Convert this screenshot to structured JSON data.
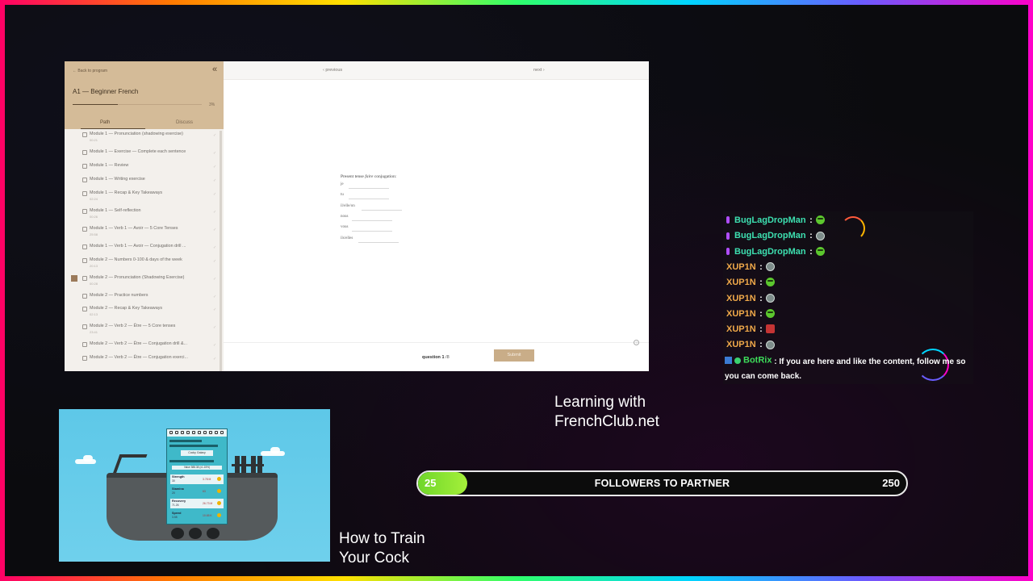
{
  "browser": {
    "sidebar": {
      "back_link": "← Back to program",
      "course_title": "A1 — Beginner French",
      "progress_pct": "3%",
      "progress_fraction": 0.35,
      "tabs": {
        "path": "Path",
        "discuss": "Discuss"
      },
      "lessons": [
        {
          "title": "Module 1 — Pronunciation (shadowing exercise)",
          "sub": "00:21"
        },
        {
          "title": "Module 1 — Exercise — Complete each sentence",
          "sub": ""
        },
        {
          "title": "Module 1 — Review",
          "sub": ""
        },
        {
          "title": "Module 1 — Writing exercise",
          "sub": ""
        },
        {
          "title": "Module 1 — Recap & Key Takeaways",
          "sub": "02:24"
        },
        {
          "title": "Module 1 — Self-reflection",
          "sub": "00:26"
        },
        {
          "title": "Module 1 — Verb 1 — Avoir — 5 Core Tenses",
          "sub": "25:58"
        },
        {
          "title": "Module 1 — Verb 1 — Avoir — Conjugation drill ...",
          "sub": ""
        },
        {
          "title": "Module 2 — Numbers 0-100 & days of the week",
          "sub": "20:13"
        },
        {
          "title": "Module 2 — Pronunciation (Shadowing Exercise)",
          "sub": "00:28"
        },
        {
          "title": "Module 2 — Practice numbers",
          "sub": ""
        },
        {
          "title": "Module 2 — Recap & Key Takeaways",
          "sub": "02:13"
        },
        {
          "title": "Module 2 — Verb 2 — Être — 5 Core tenses",
          "sub": "23:41"
        },
        {
          "title": "Module 2 — Verb 2 — Être — Conjugation drill &...",
          "sub": ""
        },
        {
          "title": "Module 2 — Verb 2 — Être — Conjugation exerci...",
          "sub": ""
        }
      ]
    },
    "nav": {
      "previous": "‹ previous",
      "next": "next ›"
    },
    "exercise": {
      "title_pre": "Present tense ",
      "title_verb": "faire",
      "title_post": " conjugation:",
      "pronouns": [
        "je",
        "tu",
        "il/elle/on",
        "nous",
        "vous",
        "ils/elles"
      ]
    },
    "footer": {
      "question_word": "question 1",
      "question_total": "/8",
      "submit": "Submit"
    }
  },
  "course_caption": {
    "line1": "Learning with",
    "line2": "FrenchClub.net"
  },
  "game": {
    "caption_line1": "How to Train",
    "caption_line2": "Your Cock",
    "card": {
      "name": "Cocky Galaxy",
      "sub": "Value 588.38 (x1.15%)",
      "stats": [
        {
          "name": "Strength",
          "level": "30",
          "cost": "3.78 M"
        },
        {
          "name": "Stamina",
          "level": "20",
          "cost": "63"
        },
        {
          "name": "Recovery",
          "level": "71.26",
          "cost": "26.73 M"
        },
        {
          "name": "Speed",
          "level": "3.55",
          "cost": "10.65 K"
        }
      ]
    }
  },
  "goal": {
    "start": "25",
    "title": "FOLLOWERS TO PARTNER",
    "end": "250",
    "fraction": 0.1
  },
  "chat": {
    "messages": [
      {
        "user": "BugLagDropMan",
        "color": "#3de0b0",
        "emote": "pepe"
      },
      {
        "user": "BugLagDropMan",
        "color": "#3de0b0",
        "emote": "ball"
      },
      {
        "user": "BugLagDropMan",
        "color": "#3de0b0",
        "emote": "pepe"
      },
      {
        "user": "XUP1N",
        "color": "#f0a94a",
        "emote": "ball"
      },
      {
        "user": "XUP1N",
        "color": "#f0a94a",
        "emote": "pepe"
      },
      {
        "user": "XUP1N",
        "color": "#f0a94a",
        "emote": "ball"
      },
      {
        "user": "XUP1N",
        "color": "#f0a94a",
        "emote": "pepe"
      },
      {
        "user": "XUP1N",
        "color": "#f0a94a",
        "emote": "red"
      },
      {
        "user": "XUP1N",
        "color": "#f0a94a",
        "emote": "ball"
      }
    ],
    "bot": {
      "user": "BotRix",
      "color": "#3ddc5a",
      "text": "If you are here and like the content, follow me so you can come back."
    },
    "colon": ":"
  }
}
